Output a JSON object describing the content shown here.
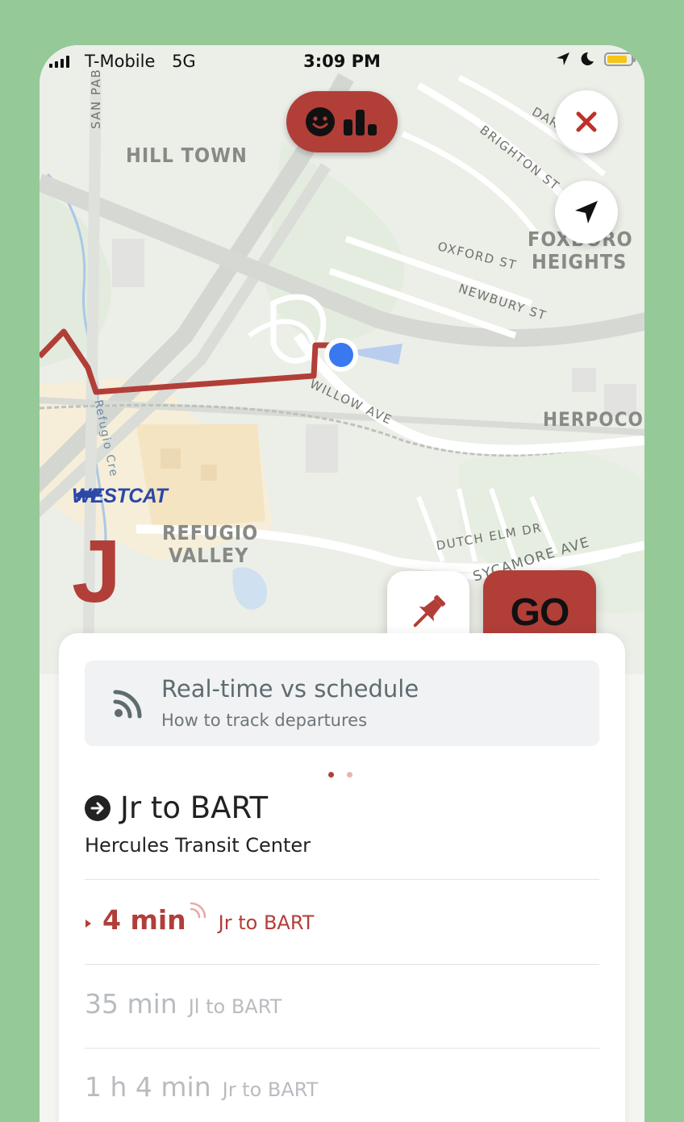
{
  "status_bar": {
    "carrier": "T-Mobile",
    "network": "5G",
    "time": "3:09 PM"
  },
  "map": {
    "neighborhoods": [
      "HILL TOWN",
      "FOXBORO",
      "HEIGHTS",
      "HERPOCO",
      "REFUGIO",
      "VALLEY"
    ],
    "streets": [
      "SAN PAB",
      "BRIGHTON ST",
      "DAR",
      "OXFORD ST",
      "NEWBURY ST",
      "WILLOW AVE",
      "Refugio Cre",
      "DUTCH ELM DR",
      "SYCAMORE AVE"
    ],
    "agency_logo": "WESTCAT",
    "route_letter": "J"
  },
  "colors": {
    "accent": "#b23e38",
    "sheet_bg": "#ffffff",
    "user_dot": "#3a78f0"
  },
  "buttons": {
    "go_label": "GO"
  },
  "info_card": {
    "title": "Real-time vs schedule",
    "subtitle": "How to track departures",
    "icon": "realtime-signal-icon"
  },
  "pager": {
    "count": 2,
    "active": 0
  },
  "direction": {
    "headsign": "Jr to BART",
    "stop": "Hercules Transit Center"
  },
  "departures": [
    {
      "time": "4 min",
      "route": "Jr to BART",
      "realtime": true
    },
    {
      "time": "35 min",
      "route": "Jl to BART",
      "realtime": false
    },
    {
      "time": "1 h 4 min",
      "route": "Jr to BART",
      "realtime": false
    }
  ]
}
